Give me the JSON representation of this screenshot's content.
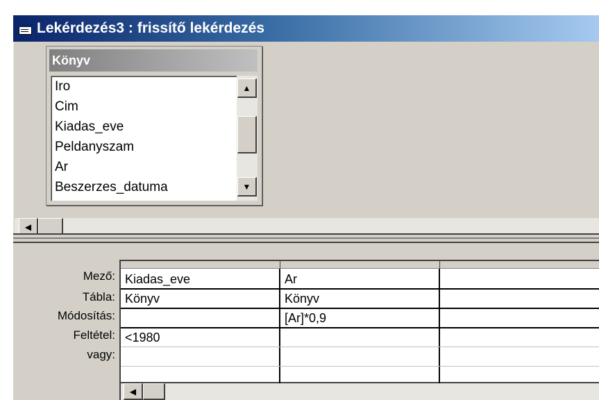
{
  "window": {
    "title": "Lekérdezés3 : frissítő lekérdezés"
  },
  "table": {
    "name": "Könyv",
    "fields": [
      "Iro",
      "Cim",
      "Kiadas_eve",
      "Peldanyszam",
      "Ar",
      "Beszerzes_datuma"
    ]
  },
  "grid": {
    "row_labels": [
      "Mező:",
      "Tábla:",
      "Módosítás:",
      "Feltétel:",
      "vagy:"
    ],
    "columns": [
      {
        "field": "Kiadas_eve",
        "table": "Könyv",
        "update": "",
        "criteria": "<1980",
        "or": ""
      },
      {
        "field": "Ar",
        "table": "Könyv",
        "update": "[Ar]*0,9",
        "criteria": "",
        "or": ""
      },
      {
        "field": "",
        "table": "",
        "update": "",
        "criteria": "",
        "or": ""
      }
    ]
  },
  "icons": {
    "scroll_up": "arrow-up-icon",
    "scroll_down": "arrow-down-icon",
    "scroll_left": "arrow-left-icon"
  }
}
